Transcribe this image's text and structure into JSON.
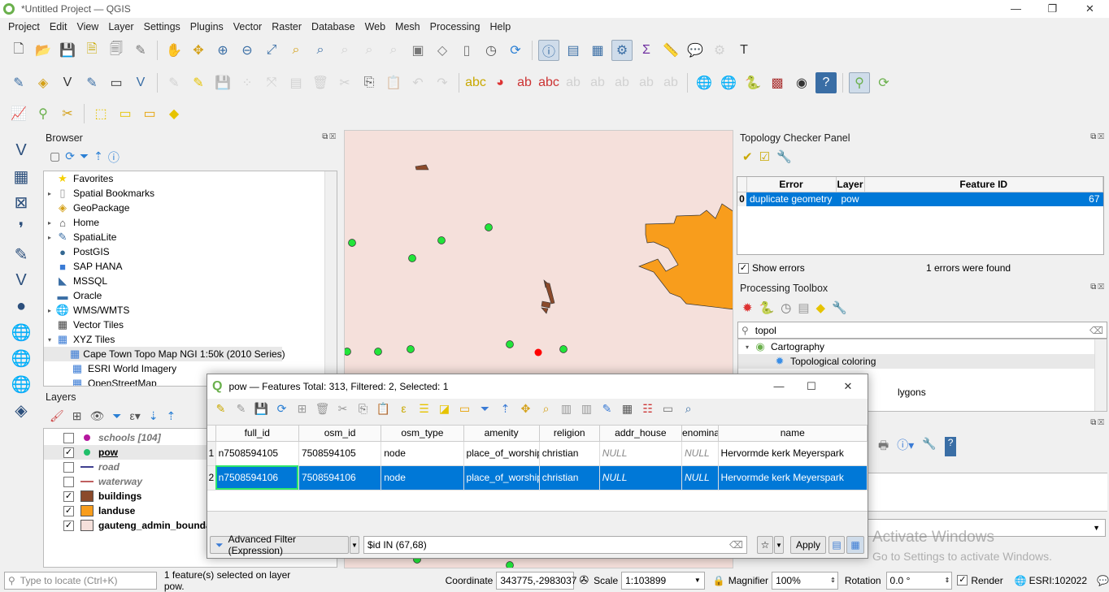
{
  "window": {
    "title": "*Untitled Project — QGIS"
  },
  "menu": [
    "Project",
    "Edit",
    "View",
    "Layer",
    "Settings",
    "Plugins",
    "Vector",
    "Raster",
    "Database",
    "Web",
    "Mesh",
    "Processing",
    "Help"
  ],
  "browser": {
    "title": "Browser",
    "items": [
      {
        "label": "Favorites",
        "icon": "star-icon",
        "glyph": "★",
        "color": "#f5d000",
        "arrow": ""
      },
      {
        "label": "Spatial Bookmarks",
        "icon": "bookmark-icon",
        "glyph": "▯",
        "color": "#999",
        "arrow": "▸"
      },
      {
        "label": "GeoPackage",
        "icon": "geopackage-icon",
        "glyph": "◈",
        "color": "#d4a017",
        "arrow": ""
      },
      {
        "label": "Home",
        "icon": "home-icon",
        "glyph": "⌂",
        "color": "#444",
        "arrow": "▸"
      },
      {
        "label": "SpatiaLite",
        "icon": "feather-icon",
        "glyph": "✎",
        "color": "#3a6ea5",
        "arrow": "▸"
      },
      {
        "label": "PostGIS",
        "icon": "elephant-icon",
        "glyph": "●",
        "color": "#336791",
        "arrow": ""
      },
      {
        "label": "SAP HANA",
        "icon": "database-icon",
        "glyph": "■",
        "color": "#3a7bd5",
        "arrow": ""
      },
      {
        "label": "MSSQL",
        "icon": "mssql-icon",
        "glyph": "◣",
        "color": "#3a6ea5",
        "arrow": ""
      },
      {
        "label": "Oracle",
        "icon": "oracle-icon",
        "glyph": "▬",
        "color": "#3a6ea5",
        "arrow": ""
      },
      {
        "label": "WMS/WMTS",
        "icon": "globe-icon",
        "glyph": "🌐",
        "color": "#3a6ea5",
        "arrow": "▸"
      },
      {
        "label": "Vector Tiles",
        "icon": "grid-icon",
        "glyph": "▦",
        "color": "#444",
        "arrow": ""
      },
      {
        "label": "XYZ Tiles",
        "icon": "tiles-icon",
        "glyph": "▦",
        "color": "#3a7bd5",
        "arrow": "▾"
      }
    ],
    "children": [
      "Cape Town Topo Map NGI 1:50k (2010 Series)",
      "ESRI World Imagery",
      "OpenStreetMap"
    ]
  },
  "layers": {
    "title": "Layers",
    "items": [
      {
        "label": "schools [104]",
        "checked": false,
        "symbol": "point",
        "color": "#b5179e",
        "style": "italic-gray"
      },
      {
        "label": "pow",
        "checked": true,
        "symbol": "point",
        "color": "#1fbf6a",
        "style": "bold-underline"
      },
      {
        "label": "road",
        "checked": false,
        "symbol": "line",
        "color": "#3f3f8f",
        "style": "italic-gray"
      },
      {
        "label": "waterway",
        "checked": false,
        "symbol": "line",
        "color": "#c06060",
        "style": "italic-gray"
      },
      {
        "label": "buildings",
        "checked": true,
        "symbol": "fill",
        "color": "#8b4a2b",
        "style": "bold"
      },
      {
        "label": "landuse",
        "checked": true,
        "symbol": "fill",
        "color": "#f89d1c",
        "style": "bold"
      },
      {
        "label": "gauteng_admin_boundaries",
        "checked": true,
        "symbol": "fill",
        "color": "#f5e0db",
        "style": "bold"
      }
    ]
  },
  "topology": {
    "title": "Topology Checker Panel",
    "columns": [
      "Error",
      "Layer",
      "Feature ID"
    ],
    "rows": [
      {
        "index": "0",
        "error": "duplicate geometry",
        "layer": "pow",
        "feature_id": "67"
      }
    ],
    "show_errors_label": "Show errors",
    "show_errors": true,
    "status": "1 errors were found"
  },
  "processing": {
    "title": "Processing Toolbox",
    "search": "topol",
    "groups": [
      {
        "label": "Cartography",
        "items": [
          "Topological coloring"
        ]
      }
    ],
    "partial_text": "lygons"
  },
  "attribute_table": {
    "title": "pow — Features Total: 313, Filtered: 2, Selected: 1",
    "columns": [
      "full_id",
      "osm_id",
      "osm_type",
      "amenity",
      "religion",
      "addr_house",
      "enomina",
      "name"
    ],
    "rows": [
      {
        "n": "1",
        "cells": [
          "n7508594105",
          "7508594105",
          "node",
          "place_of_worship",
          "christian",
          "NULL",
          "NULL",
          "Hervormde kerk Meyerspark"
        ],
        "selected": false
      },
      {
        "n": "2",
        "cells": [
          "n7508594106",
          "7508594106",
          "node",
          "place_of_worship",
          "christian",
          "NULL",
          "NULL",
          "Hervormde kerk Meyerspark"
        ],
        "selected": true
      }
    ],
    "filter_button": "Advanced Filter (Expression)",
    "expression": "$id IN (67,68)",
    "apply": "Apply"
  },
  "watermark": {
    "line1": "Activate Windows",
    "line2": "Go to Settings to activate Windows."
  },
  "status": {
    "locate_placeholder": "Type to locate (Ctrl+K)",
    "message": "1 feature(s) selected on layer pow.",
    "coordinate_label": "Coordinate",
    "coordinate": "343775,-2983037",
    "scale_label": "Scale",
    "scale": "1:103899",
    "magnifier_label": "Magnifier",
    "magnifier": "100%",
    "rotation_label": "Rotation",
    "rotation": "0.0 °",
    "render_label": "Render",
    "render": true,
    "crs": "ESRI:102022"
  },
  "colors": {
    "selection": "#0078d7",
    "map_background": "#f5e0db",
    "landuse": "#f89d1c",
    "buildings": "#8b4a2b",
    "pow_point": "#22e43a",
    "selected_point": "#ff0000"
  }
}
